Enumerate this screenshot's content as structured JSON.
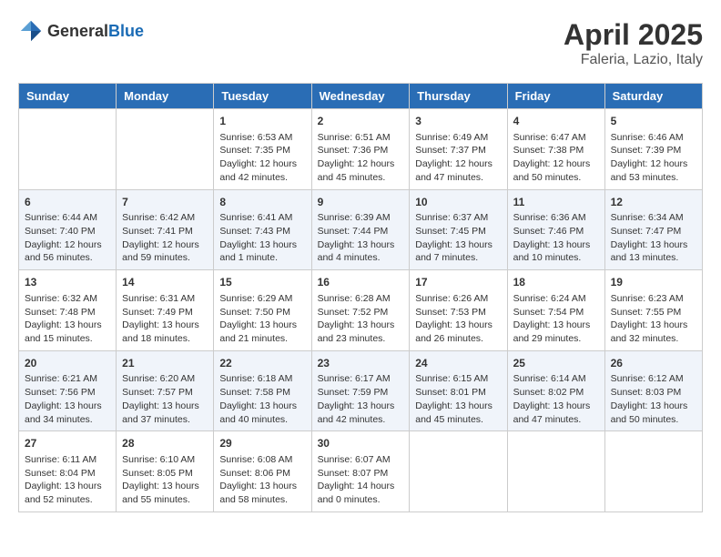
{
  "header": {
    "logo_general": "General",
    "logo_blue": "Blue",
    "month": "April 2025",
    "location": "Faleria, Lazio, Italy"
  },
  "days_of_week": [
    "Sunday",
    "Monday",
    "Tuesday",
    "Wednesday",
    "Thursday",
    "Friday",
    "Saturday"
  ],
  "weeks": [
    [
      {
        "day": "",
        "sunrise": "",
        "sunset": "",
        "daylight": ""
      },
      {
        "day": "",
        "sunrise": "",
        "sunset": "",
        "daylight": ""
      },
      {
        "day": "1",
        "sunrise": "Sunrise: 6:53 AM",
        "sunset": "Sunset: 7:35 PM",
        "daylight": "Daylight: 12 hours and 42 minutes."
      },
      {
        "day": "2",
        "sunrise": "Sunrise: 6:51 AM",
        "sunset": "Sunset: 7:36 PM",
        "daylight": "Daylight: 12 hours and 45 minutes."
      },
      {
        "day": "3",
        "sunrise": "Sunrise: 6:49 AM",
        "sunset": "Sunset: 7:37 PM",
        "daylight": "Daylight: 12 hours and 47 minutes."
      },
      {
        "day": "4",
        "sunrise": "Sunrise: 6:47 AM",
        "sunset": "Sunset: 7:38 PM",
        "daylight": "Daylight: 12 hours and 50 minutes."
      },
      {
        "day": "5",
        "sunrise": "Sunrise: 6:46 AM",
        "sunset": "Sunset: 7:39 PM",
        "daylight": "Daylight: 12 hours and 53 minutes."
      }
    ],
    [
      {
        "day": "6",
        "sunrise": "Sunrise: 6:44 AM",
        "sunset": "Sunset: 7:40 PM",
        "daylight": "Daylight: 12 hours and 56 minutes."
      },
      {
        "day": "7",
        "sunrise": "Sunrise: 6:42 AM",
        "sunset": "Sunset: 7:41 PM",
        "daylight": "Daylight: 12 hours and 59 minutes."
      },
      {
        "day": "8",
        "sunrise": "Sunrise: 6:41 AM",
        "sunset": "Sunset: 7:43 PM",
        "daylight": "Daylight: 13 hours and 1 minute."
      },
      {
        "day": "9",
        "sunrise": "Sunrise: 6:39 AM",
        "sunset": "Sunset: 7:44 PM",
        "daylight": "Daylight: 13 hours and 4 minutes."
      },
      {
        "day": "10",
        "sunrise": "Sunrise: 6:37 AM",
        "sunset": "Sunset: 7:45 PM",
        "daylight": "Daylight: 13 hours and 7 minutes."
      },
      {
        "day": "11",
        "sunrise": "Sunrise: 6:36 AM",
        "sunset": "Sunset: 7:46 PM",
        "daylight": "Daylight: 13 hours and 10 minutes."
      },
      {
        "day": "12",
        "sunrise": "Sunrise: 6:34 AM",
        "sunset": "Sunset: 7:47 PM",
        "daylight": "Daylight: 13 hours and 13 minutes."
      }
    ],
    [
      {
        "day": "13",
        "sunrise": "Sunrise: 6:32 AM",
        "sunset": "Sunset: 7:48 PM",
        "daylight": "Daylight: 13 hours and 15 minutes."
      },
      {
        "day": "14",
        "sunrise": "Sunrise: 6:31 AM",
        "sunset": "Sunset: 7:49 PM",
        "daylight": "Daylight: 13 hours and 18 minutes."
      },
      {
        "day": "15",
        "sunrise": "Sunrise: 6:29 AM",
        "sunset": "Sunset: 7:50 PM",
        "daylight": "Daylight: 13 hours and 21 minutes."
      },
      {
        "day": "16",
        "sunrise": "Sunrise: 6:28 AM",
        "sunset": "Sunset: 7:52 PM",
        "daylight": "Daylight: 13 hours and 23 minutes."
      },
      {
        "day": "17",
        "sunrise": "Sunrise: 6:26 AM",
        "sunset": "Sunset: 7:53 PM",
        "daylight": "Daylight: 13 hours and 26 minutes."
      },
      {
        "day": "18",
        "sunrise": "Sunrise: 6:24 AM",
        "sunset": "Sunset: 7:54 PM",
        "daylight": "Daylight: 13 hours and 29 minutes."
      },
      {
        "day": "19",
        "sunrise": "Sunrise: 6:23 AM",
        "sunset": "Sunset: 7:55 PM",
        "daylight": "Daylight: 13 hours and 32 minutes."
      }
    ],
    [
      {
        "day": "20",
        "sunrise": "Sunrise: 6:21 AM",
        "sunset": "Sunset: 7:56 PM",
        "daylight": "Daylight: 13 hours and 34 minutes."
      },
      {
        "day": "21",
        "sunrise": "Sunrise: 6:20 AM",
        "sunset": "Sunset: 7:57 PM",
        "daylight": "Daylight: 13 hours and 37 minutes."
      },
      {
        "day": "22",
        "sunrise": "Sunrise: 6:18 AM",
        "sunset": "Sunset: 7:58 PM",
        "daylight": "Daylight: 13 hours and 40 minutes."
      },
      {
        "day": "23",
        "sunrise": "Sunrise: 6:17 AM",
        "sunset": "Sunset: 7:59 PM",
        "daylight": "Daylight: 13 hours and 42 minutes."
      },
      {
        "day": "24",
        "sunrise": "Sunrise: 6:15 AM",
        "sunset": "Sunset: 8:01 PM",
        "daylight": "Daylight: 13 hours and 45 minutes."
      },
      {
        "day": "25",
        "sunrise": "Sunrise: 6:14 AM",
        "sunset": "Sunset: 8:02 PM",
        "daylight": "Daylight: 13 hours and 47 minutes."
      },
      {
        "day": "26",
        "sunrise": "Sunrise: 6:12 AM",
        "sunset": "Sunset: 8:03 PM",
        "daylight": "Daylight: 13 hours and 50 minutes."
      }
    ],
    [
      {
        "day": "27",
        "sunrise": "Sunrise: 6:11 AM",
        "sunset": "Sunset: 8:04 PM",
        "daylight": "Daylight: 13 hours and 52 minutes."
      },
      {
        "day": "28",
        "sunrise": "Sunrise: 6:10 AM",
        "sunset": "Sunset: 8:05 PM",
        "daylight": "Daylight: 13 hours and 55 minutes."
      },
      {
        "day": "29",
        "sunrise": "Sunrise: 6:08 AM",
        "sunset": "Sunset: 8:06 PM",
        "daylight": "Daylight: 13 hours and 58 minutes."
      },
      {
        "day": "30",
        "sunrise": "Sunrise: 6:07 AM",
        "sunset": "Sunset: 8:07 PM",
        "daylight": "Daylight: 14 hours and 0 minutes."
      },
      {
        "day": "",
        "sunrise": "",
        "sunset": "",
        "daylight": ""
      },
      {
        "day": "",
        "sunrise": "",
        "sunset": "",
        "daylight": ""
      },
      {
        "day": "",
        "sunrise": "",
        "sunset": "",
        "daylight": ""
      }
    ]
  ]
}
